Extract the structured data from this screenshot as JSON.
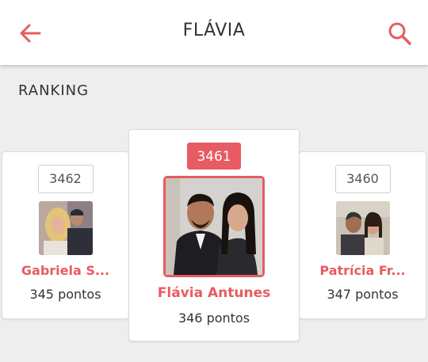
{
  "header": {
    "title": "FLÁVIA",
    "back_icon": "arrow-left-icon",
    "search_icon": "search-icon",
    "accent_color": "#e85b62"
  },
  "section": {
    "label": "RANKING"
  },
  "ranking": {
    "left": {
      "position": "3462",
      "name": "Gabriela S...",
      "points": "345 pontos"
    },
    "center": {
      "position": "3461",
      "name": "Flávia Antunes",
      "points": "346 pontos"
    },
    "right": {
      "position": "3460",
      "name": "Patrícia Fr...",
      "points": "347 pontos"
    }
  }
}
